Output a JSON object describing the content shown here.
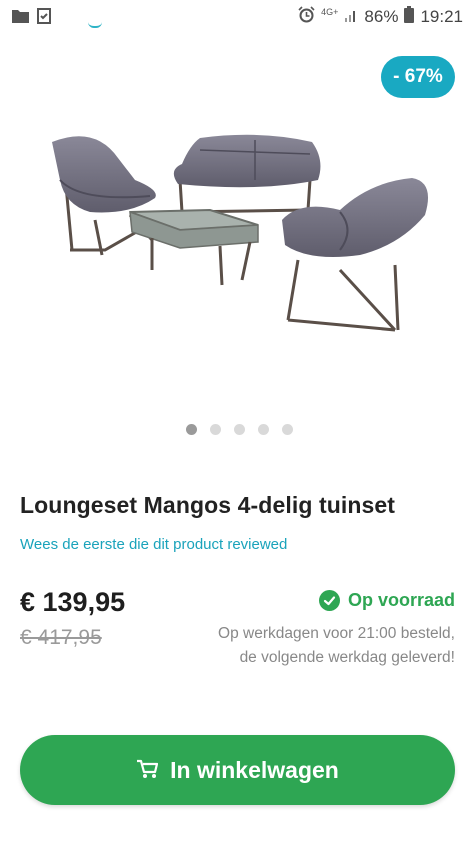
{
  "status_bar": {
    "network": "4G+",
    "battery": "86%",
    "time": "19:21",
    "icons": [
      "folder-icon",
      "checklist-icon",
      "alarm-icon",
      "signal-icon",
      "battery-icon"
    ]
  },
  "product": {
    "discount_badge": "- 67%",
    "title": "Loungeset Mangos 4-delig tuinset",
    "review_link": "Wees de eerste die dit product reviewed",
    "price": "€ 139,95",
    "old_price": "€ 417,95",
    "stock_label": "Op voorraad",
    "delivery_line1": "Op werkdagen voor 21:00 besteld,",
    "delivery_line2": "de volgende werkdag geleverd!",
    "image_alt": "loungeset-image"
  },
  "carousel": {
    "total": 5,
    "active_index": 0
  },
  "cart": {
    "label": "In winkelwagen",
    "icon": "cart-icon"
  },
  "colors": {
    "accent_blue": "#19a9c2",
    "green": "#2ea653",
    "link": "#1aa3bb"
  }
}
